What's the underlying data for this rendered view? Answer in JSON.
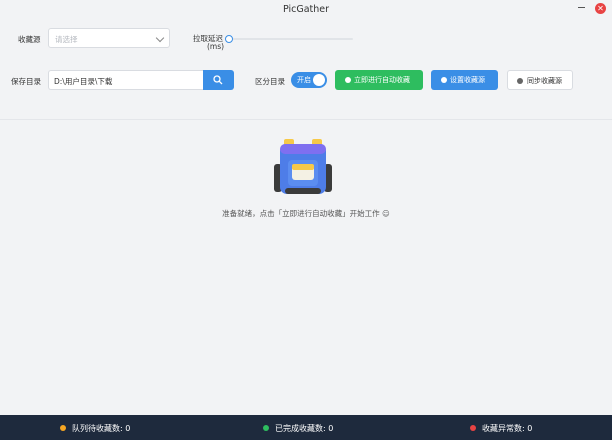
{
  "window": {
    "title": "PicGather"
  },
  "form": {
    "source_label": "收藏源",
    "source_placeholder": "请选择",
    "delay_label_line1": "拉取延迟",
    "delay_label_line2": "(ms)",
    "delay_value": 0,
    "save_dir_label": "保存目录",
    "save_dir_value": "D:\\用户目录\\下载",
    "split_dir_label": "区分目录",
    "split_dir_toggle": "开启"
  },
  "actions": {
    "start_label": "立即进行自动收藏",
    "settings_label": "设置收藏源",
    "sync_label": "同步收藏源"
  },
  "empty_state": {
    "message": "准备就绪，点击「立即进行自动收藏」开始工作 ☺"
  },
  "footer": {
    "pending_label": "队列待收藏数:",
    "pending_value": "0",
    "done_label": "已完成收藏数:",
    "done_value": "0",
    "error_label": "收藏异常数:",
    "error_value": "0"
  },
  "colors": {
    "accent": "#3a8ee6",
    "success": "#2ebd5f",
    "footer_bg": "#1e2a3d",
    "pending_dot": "#f5a623",
    "done_dot": "#2ebd5f",
    "error_dot": "#e84343"
  }
}
